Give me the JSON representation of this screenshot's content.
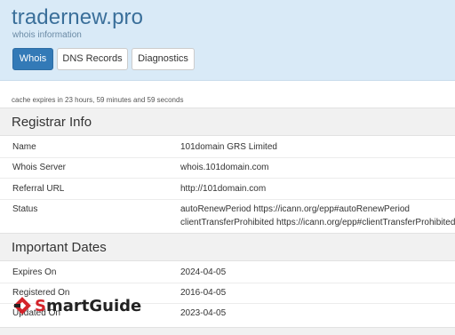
{
  "header": {
    "title": "tradernew.pro",
    "subtitle": "whois information",
    "tabs": [
      {
        "label": "Whois",
        "active": true
      },
      {
        "label": "DNS Records",
        "active": false
      },
      {
        "label": "Diagnostics",
        "active": false
      }
    ]
  },
  "cache_note": "cache expires in 23 hours, 59 minutes and 59 seconds",
  "registrar": {
    "heading": "Registrar Info",
    "rows": [
      {
        "label": "Name",
        "value": "101domain GRS Limited"
      },
      {
        "label": "Whois Server",
        "value": "whois.101domain.com"
      },
      {
        "label": "Referral URL",
        "value": "http://101domain.com"
      },
      {
        "label": "Status",
        "value": "autoRenewPeriod https://icann.org/epp#autoRenewPeriod",
        "value2": "clientTransferProhibited https://icann.org/epp#clientTransferProhibited"
      }
    ]
  },
  "dates": {
    "heading": "Important Dates",
    "rows": [
      {
        "label": "Expires On",
        "value": "2024-04-05"
      },
      {
        "label": "Registered On",
        "value": "2016-04-05"
      },
      {
        "label": "Updated On",
        "value": "2023-04-05"
      }
    ]
  },
  "watermark": {
    "text_accent": "S",
    "text_rest": "martGuide",
    "logo_icon": "smartguide-logo-icon",
    "color": "#d3232a"
  }
}
